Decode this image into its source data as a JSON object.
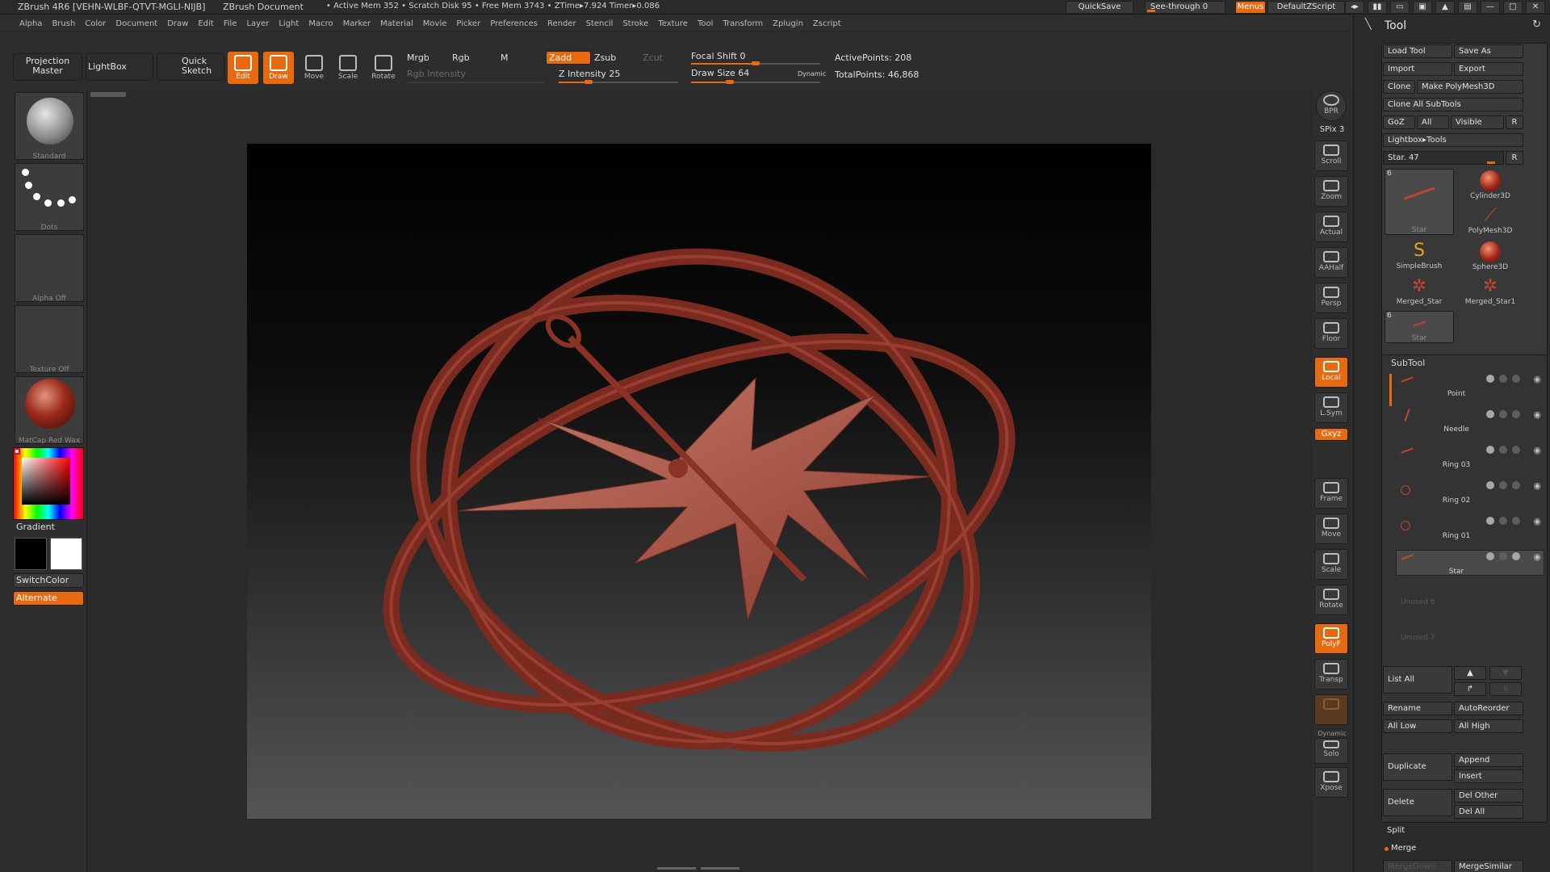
{
  "title": {
    "app": "ZBrush 4R6 [VEHN-WLBF-QTVT-MGLI-NIJB]",
    "document": "ZBrush Document",
    "memory": "• Active Mem 352 • Scratch Disk 95 • Free Mem 3743 • ZTime▸7.924 Timer▸0.086",
    "quicksave": "QuickSave",
    "see_through": "See-through 0",
    "menus": "Menus",
    "script": "DefaultZScript"
  },
  "menu": [
    "Alpha",
    "Brush",
    "Color",
    "Document",
    "Draw",
    "Edit",
    "File",
    "Layer",
    "Light",
    "Macro",
    "Marker",
    "Material",
    "Movie",
    "Picker",
    "Preferences",
    "Render",
    "Stencil",
    "Stroke",
    "Texture",
    "Tool",
    "Transform",
    "Zplugin",
    "Zscript"
  ],
  "shelf": {
    "projection_master": "Projection Master",
    "lightbox": "LightBox",
    "quick_sketch": "Quick Sketch",
    "edit": "Edit",
    "draw": "Draw",
    "move": "Move",
    "scale": "Scale",
    "rotate": "Rotate",
    "mrgb": "Mrgb",
    "rgb": "Rgb",
    "m": "M",
    "rgb_intensity": "Rgb Intensity",
    "zadd": "Zadd",
    "zsub": "Zsub",
    "zcut": "Zcut",
    "z_intensity": "Z Intensity 25",
    "z_intensity_value": 0.25,
    "focal_shift": "Focal Shift 0",
    "focal_shift_value": 0.5,
    "draw_size": "Draw Size 64",
    "draw_size_value": 0.3,
    "dynamic": "Dynamic",
    "active_points": "ActivePoints: 208",
    "total_points": "TotalPoints: 46,868"
  },
  "left": {
    "brush": "Standard",
    "stroke": "Dots",
    "alpha": "Alpha Off",
    "texture": "Texture Off",
    "material": "MatCap Red Wax",
    "gradient": "Gradient",
    "switch_color": "SwitchColor",
    "alternate": "Alternate"
  },
  "right_shelf": {
    "bpr": "BPR",
    "spix": "SPix 3",
    "scroll": "Scroll",
    "zoom": "Zoom",
    "actual": "Actual",
    "aahalf": "AAHalf",
    "persp": "Persp",
    "floor": "Floor",
    "local": "Local",
    "lsym": "L.Sym",
    "xyz": "Gxyz",
    "frame": "Frame",
    "move": "Move",
    "scale": "Scale",
    "rotate": "Rotate",
    "polyf": "PolyF",
    "transp": "Transp",
    "dynamic": "Dynamic",
    "solo": "Solo",
    "xpose": "Xpose"
  },
  "tool_panel": {
    "title": "Tool",
    "load_tool": "Load Tool",
    "save_as": "Save As",
    "import": "Import",
    "export": "Export",
    "clone": "Clone",
    "make_polymesh": "Make PolyMesh3D",
    "clone_all": "Clone All SubTools",
    "goz": "GoZ",
    "all": "All",
    "visible": "Visible",
    "r": "R",
    "lightbox_tools": "Lightbox▸Tools",
    "star_slider": "Star. 47",
    "tools": [
      {
        "name": "Star",
        "num": "6"
      },
      {
        "name": "Cylinder3D"
      },
      {
        "name": "PolyMesh3D"
      },
      {
        "name": "SimpleBrush"
      },
      {
        "name": "Sphere3D"
      },
      {
        "name": "Merged_Star"
      },
      {
        "name": "Merged_Star1"
      },
      {
        "name": "Star",
        "num": "6"
      }
    ],
    "subtool_title": "SubTool",
    "subtools": [
      "Point",
      "Needle",
      "Ring 03",
      "Ring 02",
      "Ring 01",
      "Star"
    ],
    "unused": [
      "Unused 6",
      "Unused 7"
    ],
    "list_all": "List All",
    "rename": "Rename",
    "autoreorder": "AutoReorder",
    "all_low": "All Low",
    "all_high": "All High",
    "duplicate": "Duplicate",
    "append": "Append",
    "insert": "Insert",
    "delete": "Delete",
    "del_other": "Del Other",
    "del_all": "Del All",
    "split": "Split",
    "merge": "Merge",
    "merge_down": "MergeDown",
    "merge_similar": "MergeSimilar"
  }
}
